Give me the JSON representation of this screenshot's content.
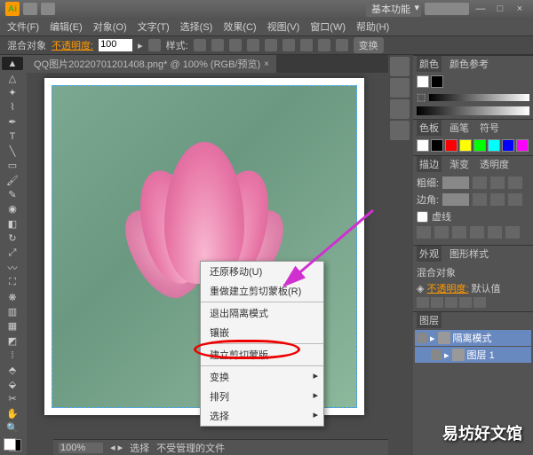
{
  "titlebar": {
    "mode_label": "基本功能"
  },
  "menu": [
    "文件(F)",
    "编辑(E)",
    "对象(O)",
    "文字(T)",
    "选择(S)",
    "效果(C)",
    "视图(V)",
    "窗口(W)",
    "帮助(H)"
  ],
  "options": {
    "target": "混合对象",
    "opacity_label": "不透明度:",
    "opacity_value": "100",
    "style_label": "样式:",
    "transform_btn": "变换"
  },
  "doctab": {
    "title": "QQ图片20220701201408.png* @ 100% (RGB/预览)"
  },
  "context_menu": [
    "还原移动(U)",
    "重做建立剪切蒙板(R)",
    "退出隔离模式",
    "镶嵌",
    "建立剪切蒙版",
    "变换",
    "排列",
    "选择"
  ],
  "status": {
    "zoom": "100%",
    "tool": "选择",
    "hint": "不受管理的文件"
  },
  "panels": {
    "color": {
      "tabs": [
        "颜色",
        "颜色参考"
      ]
    },
    "swatches": {
      "tabs": [
        "色板",
        "画笔",
        "符号"
      ]
    },
    "stroke": {
      "tabs": [
        "描边",
        "渐变",
        "透明度"
      ],
      "weight_label": "粗细:",
      "dash_label": "虚线",
      "corner_label": "边角:"
    },
    "appearance": {
      "tabs": [
        "外观",
        "图形样式"
      ],
      "target": "混合对象",
      "opacity_label": "不透明度:",
      "opacity_value": "默认值"
    },
    "layers": {
      "tabs": [
        "图层"
      ],
      "rows": [
        "隔离模式",
        "图层 1"
      ]
    }
  },
  "watermark": "易坊好文馆"
}
